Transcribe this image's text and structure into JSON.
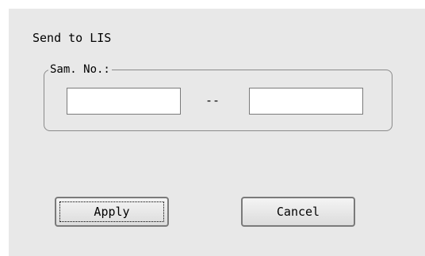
{
  "dialog": {
    "title": "Send to LIS",
    "sample_group": {
      "label": "Sam. No.:",
      "from_value": "",
      "separator": "--",
      "to_value": ""
    },
    "buttons": {
      "apply": "Apply",
      "cancel": "Cancel"
    }
  }
}
